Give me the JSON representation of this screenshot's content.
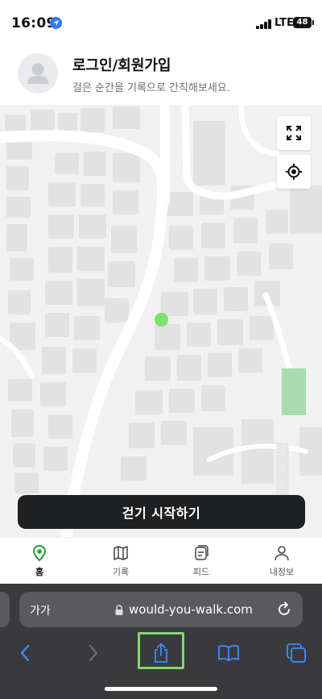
{
  "status_bar": {
    "time": "16:09",
    "network": "LTE",
    "battery": "48"
  },
  "header": {
    "title": "로그인/회원가입",
    "subtitle": "걸은 순간을 기록으로 간직해보세요."
  },
  "map": {
    "start_button_label": "걷기 시작하기",
    "current_location_color": "#7ee06e",
    "park_color": "#a8dcae"
  },
  "tabbar": {
    "tabs": [
      {
        "label": "홈",
        "icon": "location-pin-icon",
        "active": true
      },
      {
        "label": "기록",
        "icon": "map-icon",
        "active": false
      },
      {
        "label": "피드",
        "icon": "feed-icon",
        "active": false
      },
      {
        "label": "내정보",
        "icon": "profile-icon",
        "active": false
      }
    ]
  },
  "browser": {
    "text_size_label": "가가",
    "url": "would-you-walk.com",
    "accent_color": "#2f7cf6",
    "highlight_color": "#7ed96a"
  }
}
